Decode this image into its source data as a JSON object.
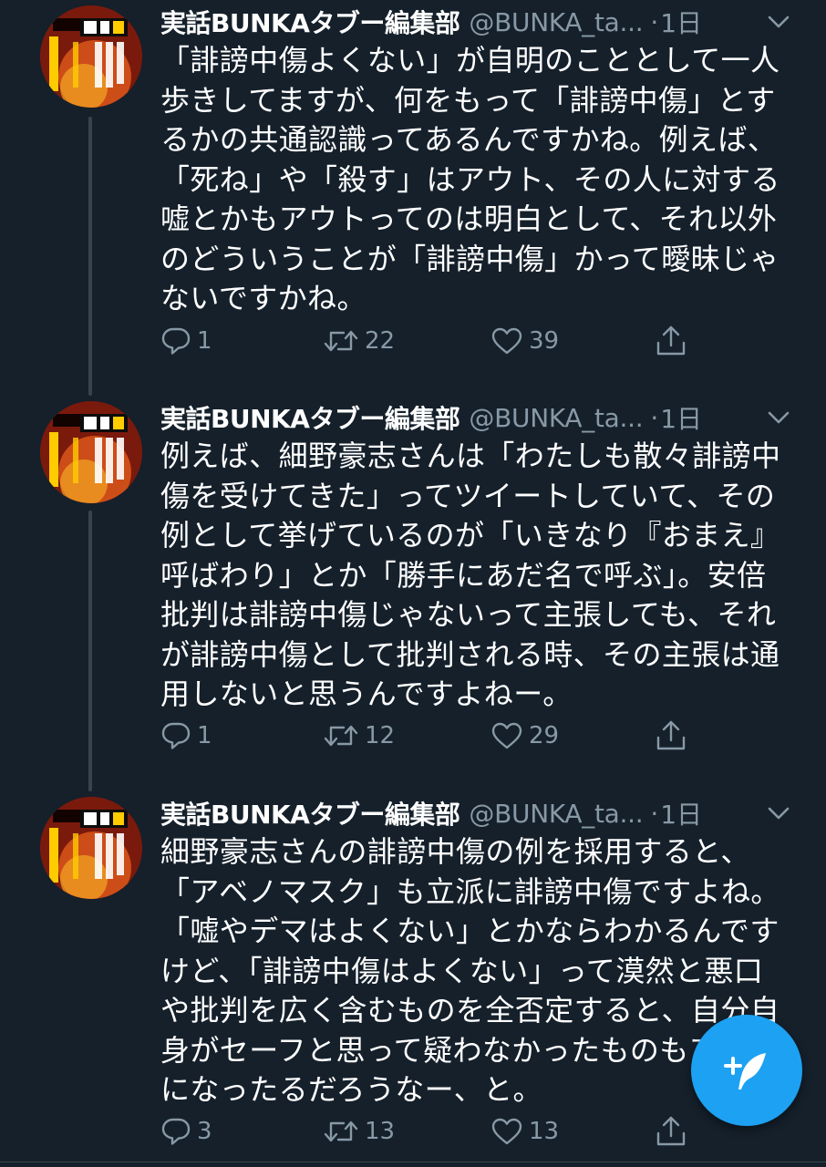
{
  "theme": {
    "background": "#15202b",
    "text_primary": "#ffffff",
    "text_secondary": "#8899a6",
    "accent": "#1da1f2",
    "thread_line": "#38444d"
  },
  "tweets": [
    {
      "display_name": "実話BUNKAタブー編集部",
      "handle": "@BUNKA_ta...",
      "dot": "·",
      "time": "1日",
      "text": "「誹謗中傷よくない」が自明のこととして一人歩きしてますが、何をもって「誹謗中傷」とするかの共通認識ってあるんですかね。例えば、「死ね」や「殺す」はアウト、その人に対する嘘とかもアウトってのは明白として、それ以外のどういうことが「誹謗中傷」かって曖昧じゃないですかね。",
      "replies": "1",
      "retweets": "22",
      "likes": "39"
    },
    {
      "display_name": "実話BUNKAタブー編集部",
      "handle": "@BUNKA_ta...",
      "dot": "·",
      "time": "1日",
      "text": "例えば、細野豪志さんは「わたしも散々誹謗中傷を受けてきた」ってツイートしていて、その例として挙げているのが「いきなり『おまえ』呼ばわり」とか「勝手にあだ名で呼ぶ」。安倍批判は誹謗中傷じゃないって主張しても、それが誹謗中傷として批判される時、その主張は通用しないと思うんですよねー。",
      "replies": "1",
      "retweets": "12",
      "likes": "29"
    },
    {
      "display_name": "実話BUNKAタブー編集部",
      "handle": "@BUNKA_ta...",
      "dot": "·",
      "time": "1日",
      "text": "細野豪志さんの誹謗中傷の例を採用すると、「アベノマスク」も立派に誹謗中傷ですよね。「嘘やデマはよくない」とかならわかるんですけど、「誹謗中傷はよくない」って漠然と悪口や批判を広く含むものを全否定すると、自分自身がセーフと思って疑わなかったものもアウトになったるだろうなー、と。",
      "replies": "3",
      "retweets": "13",
      "likes": "13"
    }
  ],
  "icons": {
    "reply": "reply-icon",
    "retweet": "retweet-icon",
    "like": "heart-icon",
    "share": "share-icon",
    "caret": "chevron-down-icon",
    "compose": "compose-tweet-icon"
  }
}
